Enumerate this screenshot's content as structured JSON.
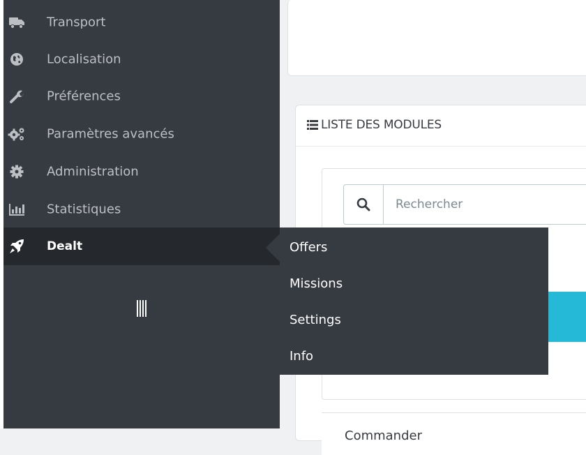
{
  "sidebar": {
    "items": [
      {
        "label": "Transport",
        "icon": "truck-icon"
      },
      {
        "label": "Localisation",
        "icon": "globe-icon"
      },
      {
        "label": "Préférences",
        "icon": "wrench-icon"
      },
      {
        "label": "Paramètres avancés",
        "icon": "cogs-icon"
      },
      {
        "label": "Administration",
        "icon": "cog-icon"
      },
      {
        "label": "Statistiques",
        "icon": "bar-chart-icon"
      },
      {
        "label": "Dealt",
        "icon": "rocket-icon",
        "active": true
      }
    ],
    "collapse_icon": "collapse-bars-icon"
  },
  "submenu": {
    "items": [
      "Offers",
      "Missions",
      "Settings",
      "Info"
    ]
  },
  "modules_panel": {
    "title": "LISTE DES MODULES",
    "search": {
      "placeholder": "Rechercher"
    },
    "bottom_label": "Commander"
  },
  "colors": {
    "sidebar_bg": "#363a41",
    "active_bg": "#25282d",
    "accent_blue": "#25b9d7"
  }
}
